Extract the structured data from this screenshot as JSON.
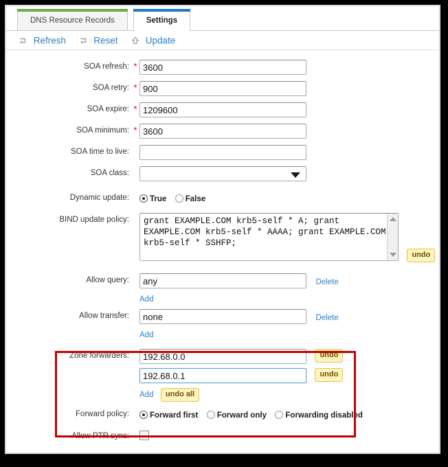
{
  "tabs": [
    {
      "label": "DNS Resource Records",
      "active": false,
      "accent": "#67ad45"
    },
    {
      "label": "Settings",
      "active": true,
      "accent": "#2079c7"
    }
  ],
  "toolbar": {
    "refresh_label": "Refresh",
    "reset_label": "Reset",
    "update_label": "Update"
  },
  "form": {
    "soa_refresh": {
      "label": "SOA refresh:",
      "required": "*",
      "value": "3600"
    },
    "soa_retry": {
      "label": "SOA retry:",
      "required": "*",
      "value": "900"
    },
    "soa_expire": {
      "label": "SOA expire:",
      "required": "*",
      "value": "1209600"
    },
    "soa_minimum": {
      "label": "SOA minimum:",
      "required": "*",
      "value": "3600"
    },
    "soa_ttl": {
      "label": "SOA time to live:",
      "value": ""
    },
    "soa_class": {
      "label": "SOA class:",
      "value": ""
    },
    "dynamic_update": {
      "label": "Dynamic update:",
      "options": [
        "True",
        "False"
      ],
      "selected": "True"
    },
    "bind_update_policy": {
      "label": "BIND update policy:",
      "value": "grant EXAMPLE.COM krb5-self * A; grant EXAMPLE.COM krb5-self * AAAA; grant EXAMPLE.COM krb5-self * SSHFP;",
      "undo_label": "undo"
    },
    "allow_query": {
      "label": "Allow query:",
      "value": "any",
      "delete_label": "Delete",
      "add_label": "Add"
    },
    "allow_transfer": {
      "label": "Allow transfer:",
      "value": "none",
      "delete_label": "Delete",
      "add_label": "Add"
    },
    "zone_forwarders": {
      "label": "Zone forwarders:",
      "entries": [
        {
          "value": "192.68.0.0",
          "undo_label": "undo",
          "focused": false
        },
        {
          "value": "192.68.0.1",
          "undo_label": "undo",
          "focused": true
        }
      ],
      "add_label": "Add",
      "undo_all_label": "undo all"
    },
    "forward_policy": {
      "label": "Forward policy:",
      "options": [
        "Forward first",
        "Forward only",
        "Forwarding disabled"
      ],
      "selected": "Forward first"
    },
    "allow_ptr_sync": {
      "label": "Allow PTR sync:",
      "checked": false
    }
  },
  "colors": {
    "link": "#2c80c6",
    "required_star": "#d40000",
    "highlight_box": "#c00000",
    "undo_bg": "#fdf3bd",
    "undo_border": "#e4c44a"
  }
}
